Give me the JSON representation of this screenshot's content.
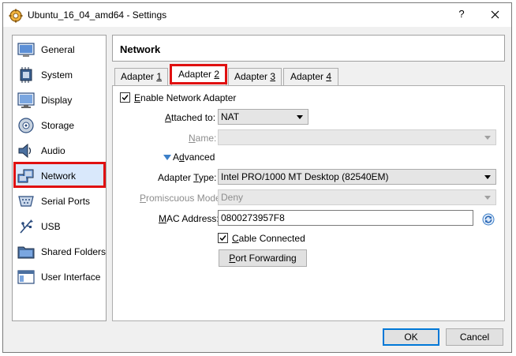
{
  "window": {
    "title": "Ubuntu_16_04_amd64 - Settings",
    "help_label": "?",
    "close_icon": "close-icon",
    "app_icon": "virtualbox-settings-icon"
  },
  "sidebar": {
    "items": [
      {
        "label": "General",
        "icon": "general-icon"
      },
      {
        "label": "System",
        "icon": "system-icon"
      },
      {
        "label": "Display",
        "icon": "display-icon"
      },
      {
        "label": "Storage",
        "icon": "storage-icon"
      },
      {
        "label": "Audio",
        "icon": "audio-icon"
      },
      {
        "label": "Network",
        "icon": "network-icon",
        "selected": true
      },
      {
        "label": "Serial Ports",
        "icon": "serial-ports-icon"
      },
      {
        "label": "USB",
        "icon": "usb-icon"
      },
      {
        "label": "Shared Folders",
        "icon": "shared-folders-icon"
      },
      {
        "label": "User Interface",
        "icon": "user-interface-icon"
      }
    ]
  },
  "header": {
    "title": "Network"
  },
  "tabs": [
    {
      "prefix": "Adapter ",
      "accel": "1",
      "active": false
    },
    {
      "prefix": "Adapter ",
      "accel": "2",
      "active": true
    },
    {
      "prefix": "Adapter ",
      "accel": "3",
      "active": false
    },
    {
      "prefix": "Adapter ",
      "accel": "4",
      "active": false
    }
  ],
  "form": {
    "enable_adapter": {
      "accel": "E",
      "rest": "nable Network Adapter",
      "checked": true
    },
    "attached_to": {
      "accel": "A",
      "rest": "ttached to:",
      "value": "NAT"
    },
    "name": {
      "accel": "N",
      "rest": "ame:",
      "value": "",
      "disabled": true
    },
    "advanced": {
      "accel": "d",
      "pre": "A",
      "rest": "vanced",
      "expanded": true
    },
    "adapter_type": {
      "pre": "Adapter ",
      "accel": "T",
      "rest": "ype:",
      "value": "Intel PRO/1000 MT Desktop (82540EM)"
    },
    "promiscuous": {
      "accel": "P",
      "rest": "romiscuous Mode:",
      "value": "Deny",
      "disabled": true
    },
    "mac": {
      "accel": "M",
      "rest": "AC Address:",
      "value": "0800273957F8"
    },
    "cable": {
      "accel": "C",
      "rest": "able Connected",
      "checked": true
    },
    "port_forwarding": {
      "accel": "P",
      "rest": "ort Forwarding"
    }
  },
  "footer": {
    "ok_label": "OK",
    "cancel_label": "Cancel"
  },
  "colors": {
    "highlight_border": "#e01010",
    "accent": "#0078d7"
  }
}
